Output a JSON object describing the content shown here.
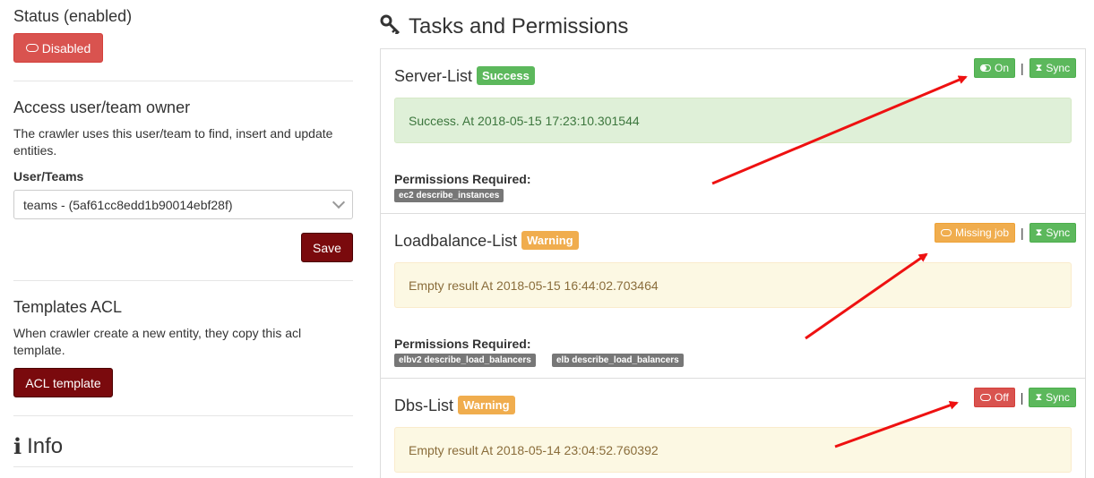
{
  "left": {
    "status_heading": "Status (enabled)",
    "status_button": "Disabled",
    "access_heading": "Access user/team owner",
    "access_desc": "The crawler uses this user/team to find, insert and update entities.",
    "user_teams_label": "User/Teams",
    "user_teams_value": "teams - (5af61cc8edd1b90014ebf28f)",
    "save_label": "Save",
    "templates_heading": "Templates ACL",
    "templates_desc": "When crawler create a new entity, they copy this acl template.",
    "acl_button": "ACL template",
    "info_icon": "i",
    "info_heading": "Info"
  },
  "right": {
    "title": "Tasks and Permissions",
    "title_icon": "key-icon",
    "separator": "|",
    "sync_label": "Sync",
    "permissions_heading": "Permissions Required:",
    "tasks": [
      {
        "name": "Server-List",
        "status_label": "Success",
        "state_button": "On",
        "message": "Success. At 2018-05-15 17:23:10.301544",
        "permissions": [
          "ec2 describe_instances"
        ]
      },
      {
        "name": "Loadbalance-List",
        "status_label": "Warning",
        "state_button": "Missing job",
        "message": "Empty result At 2018-05-15 16:44:02.703464",
        "permissions": [
          "elbv2 describe_load_balancers",
          "elb describe_load_balancers"
        ]
      },
      {
        "name": "Dbs-List",
        "status_label": "Warning",
        "state_button": "Off",
        "message": "Empty result At 2018-05-14 23:04:52.760392",
        "permissions": []
      }
    ]
  },
  "colors": {
    "danger": "#d9534f",
    "success": "#5cb85c",
    "warning": "#f0ad4e",
    "brand_dark_red": "#7a0a0d",
    "arrow": "#ee1111"
  }
}
